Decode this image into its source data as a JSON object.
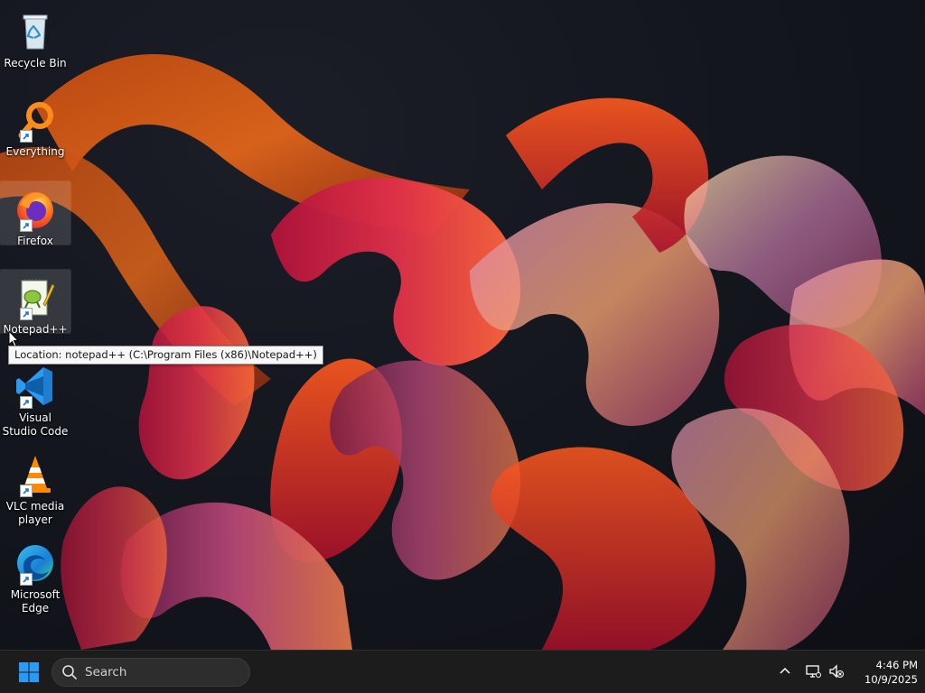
{
  "desktop": {
    "icons": [
      {
        "label": "Recycle Bin",
        "icon": "recycle-bin-icon",
        "shortcut": false,
        "selected": false
      },
      {
        "label": "Everything",
        "icon": "everything-search-icon",
        "shortcut": true,
        "selected": false
      },
      {
        "label": "Firefox",
        "icon": "firefox-icon",
        "shortcut": true,
        "selected": true
      },
      {
        "label": "Notepad++",
        "icon": "notepadplusplus-icon",
        "shortcut": true,
        "selected": true
      },
      {
        "label": "Visual Studio Code",
        "icon": "vscode-icon",
        "shortcut": true,
        "selected": false
      },
      {
        "label": "VLC media player",
        "icon": "vlc-icon",
        "shortcut": true,
        "selected": false
      },
      {
        "label": "Microsoft Edge",
        "icon": "edge-icon",
        "shortcut": true,
        "selected": false
      }
    ],
    "tooltip": "Location: notepad++ (C:\\Program Files (x86)\\Notepad++)"
  },
  "taskbar": {
    "search_placeholder": "Search",
    "start_icon": "windows-logo-icon",
    "tray_icons": [
      "chevron-up-icon",
      "network-icon",
      "volume-muted-icon"
    ],
    "time": "4:46 PM",
    "date": "10/9/2025"
  },
  "colors": {
    "taskbar_bg": "#1c1c1c",
    "windows_blue": "#2b9af3",
    "wallpaper_bg": "#14161e"
  }
}
